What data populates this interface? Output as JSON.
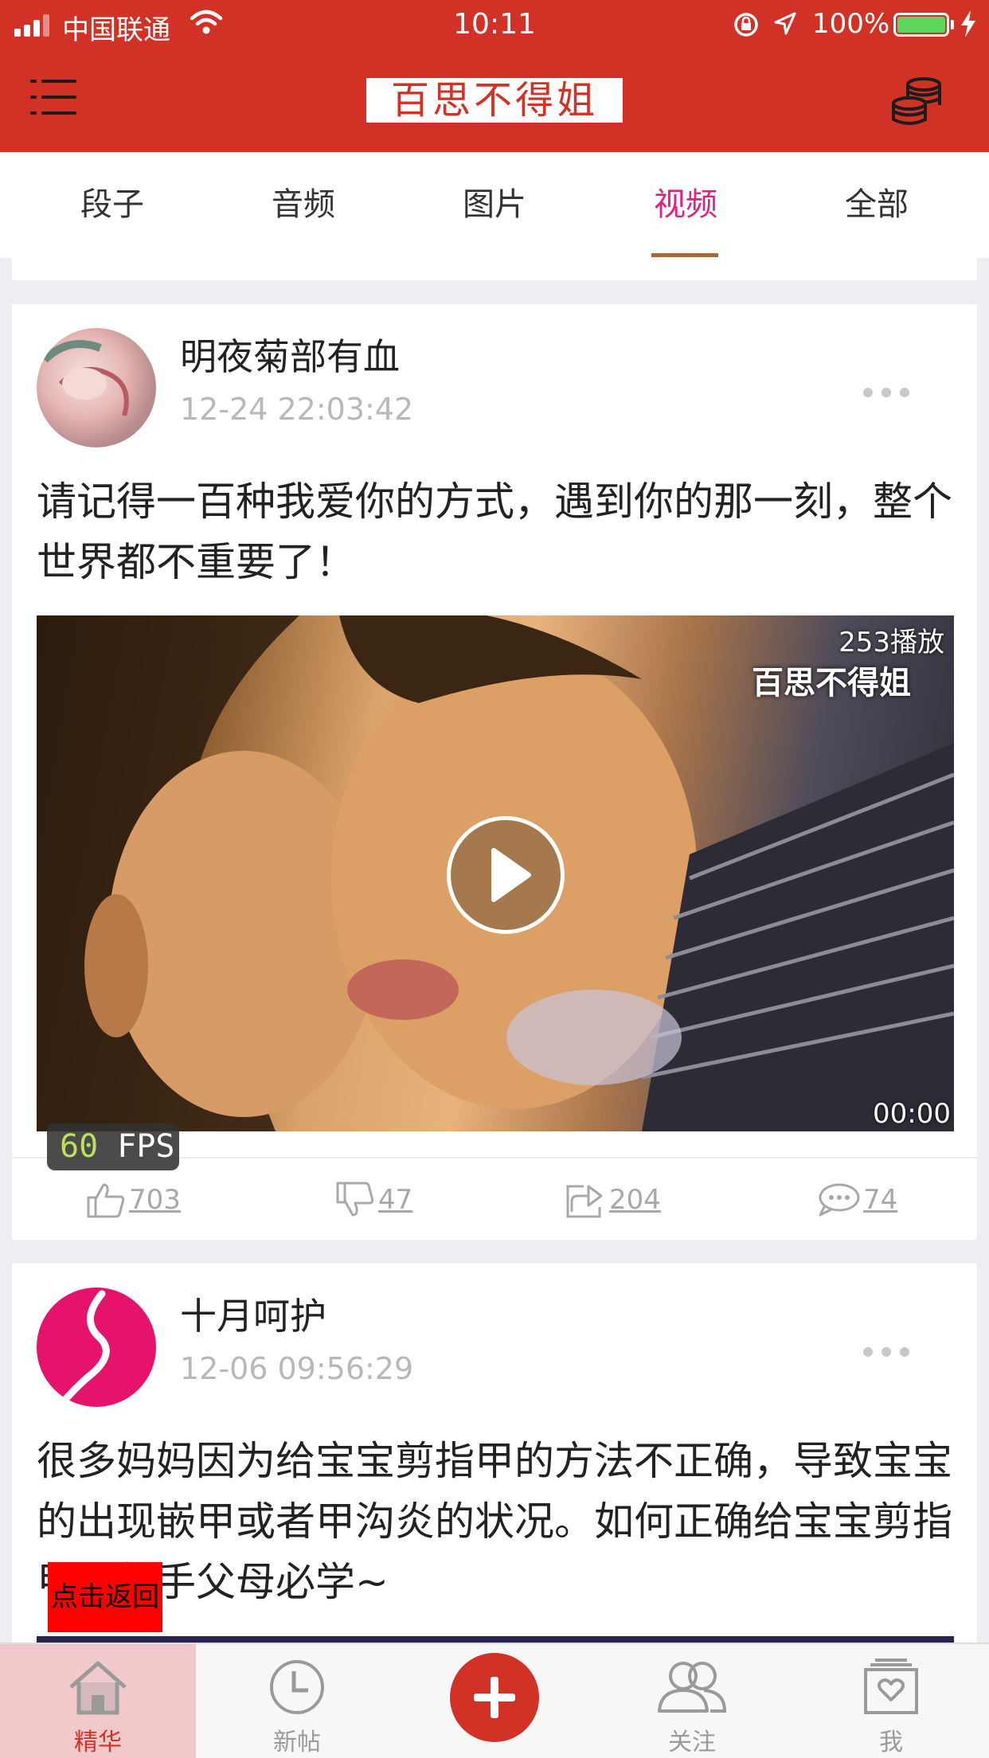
{
  "status_bar": {
    "carrier": "中国联通",
    "time": "10:11",
    "battery": "100%"
  },
  "header": {
    "logo": "百思不得姐"
  },
  "tabs": [
    {
      "label": "段子"
    },
    {
      "label": "音频"
    },
    {
      "label": "图片"
    },
    {
      "label": "视频",
      "active": true
    },
    {
      "label": "全部"
    }
  ],
  "posts": [
    {
      "username": "明夜菊部有血",
      "time": "12-24 22:03:42",
      "text": "请记得一百种我爱你的方式，遇到你的那一刻，整个世界都不重要了！",
      "play_count": "253播放",
      "watermark": "百思不得姐",
      "duration": "00:00",
      "likes": "703",
      "dislikes": "47",
      "shares": "204",
      "comments": "74"
    },
    {
      "username": "十月呵护",
      "time": "12-06 09:56:29",
      "text": "很多妈妈因为给宝宝剪指甲的方法不正确，导致宝宝的出现嵌甲或者甲沟炎的状况。如何正确给宝宝剪指甲？新手父母必学~"
    }
  ],
  "fps": {
    "value": "60",
    "unit": "FPS"
  },
  "back_overlay": "点击返回",
  "tabbar": [
    {
      "label": "精华",
      "active": true
    },
    {
      "label": "新帖"
    },
    {
      "label": "关注"
    },
    {
      "label": "我"
    }
  ],
  "colors": {
    "brand_red": "#d23126",
    "active_tab": "#e51f7e",
    "tab_underline": "#a8663c"
  }
}
